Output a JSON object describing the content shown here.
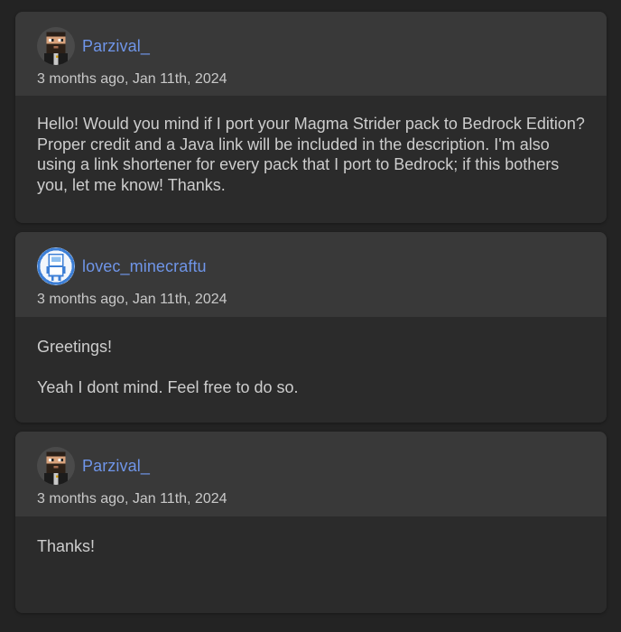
{
  "comments": [
    {
      "author": "Parzival_",
      "avatar_icon": "pixel-bearded-man-avatar",
      "timestamp": "3 months ago, Jan 11th, 2024",
      "paragraphs": [
        "Hello! Would you mind if I port your Magma Strider pack to Bedrock Edition? Proper credit and a Java link will be included in the description. I'm also using a link shortener for every pack that I port to Bedrock; if this bothers you, let me know! Thanks."
      ]
    },
    {
      "author": "lovec_minecraftu",
      "avatar_icon": "pixel-robot-avatar",
      "timestamp": "3 months ago, Jan 11th, 2024",
      "paragraphs": [
        "Greetings!",
        "Yeah I dont mind. Feel free to do so."
      ]
    },
    {
      "author": "Parzival_",
      "avatar_icon": "pixel-bearded-man-avatar",
      "timestamp": "3 months ago, Jan 11th, 2024",
      "paragraphs": [
        "Thanks!"
      ]
    }
  ],
  "colors": {
    "page_background": "#232323",
    "header_background": "#393939",
    "body_background": "#2b2b2b",
    "author_link": "#6f95e8",
    "body_text": "#cdcdcd"
  }
}
